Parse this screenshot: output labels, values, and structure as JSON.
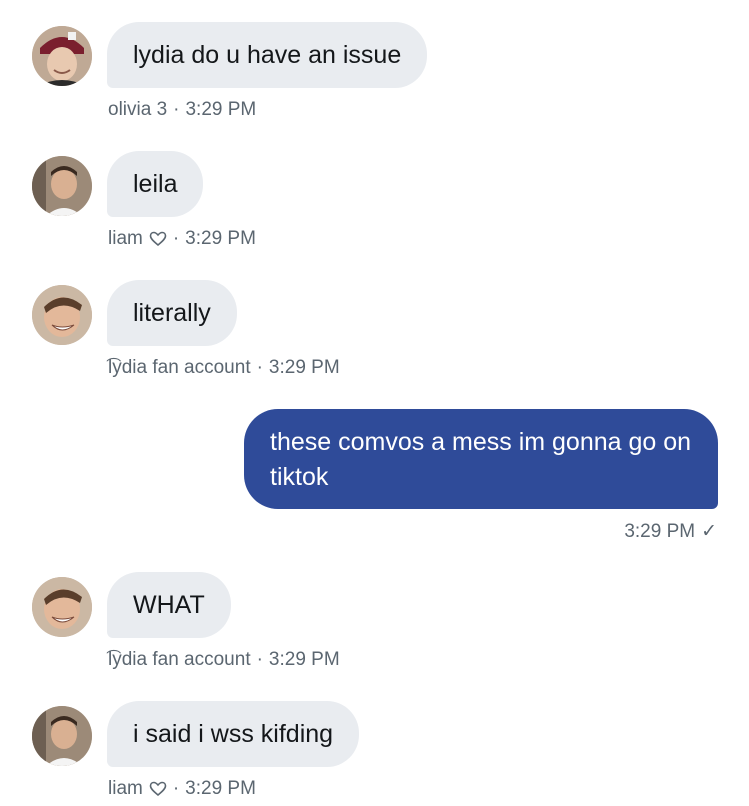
{
  "messages": [
    {
      "text": "lydia do u have an issue",
      "sender": "olivia 3",
      "time": "3:29 PM",
      "heart": false
    },
    {
      "text": "leila",
      "sender": "liam",
      "time": "3:29 PM",
      "heart": true
    },
    {
      "text": "literally",
      "sender": "͡lydia fan account",
      "time": "3:29 PM",
      "heart": false
    },
    {
      "text": "these comvos a mess im gonna go on tiktok",
      "time": "3:29 PM",
      "check": "✓",
      "outgoing": true
    },
    {
      "text": "WHAT",
      "sender": "͡lydia fan account",
      "time": "3:29 PM",
      "heart": false
    },
    {
      "text": "i said i wss kifding",
      "sender": "liam",
      "time": "3:29 PM",
      "heart": true
    }
  ],
  "separator": "·",
  "colors": {
    "incoming_bubble": "#e9ecf0",
    "outgoing_bubble": "#2f4b99",
    "meta_text": "#5b6670"
  },
  "icons": {
    "heart": "heart-outline-icon",
    "checkmark": "checkmark-icon"
  }
}
